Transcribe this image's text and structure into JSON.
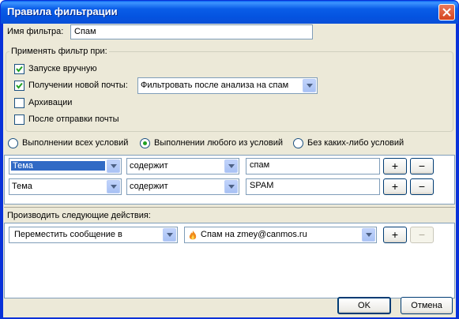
{
  "window": {
    "title": "Правила фильтрации",
    "close_label": "✕"
  },
  "filter_name": {
    "label": "Имя фильтра:",
    "value": "Спам"
  },
  "apply_group": {
    "title": "Применять фильтр при:",
    "options": [
      {
        "label": "Запуске вручную",
        "checked": true
      },
      {
        "label": "Получении новой почты:",
        "checked": true
      },
      {
        "label": "Архивации",
        "checked": false
      },
      {
        "label": "После отправки почты",
        "checked": false
      }
    ],
    "new_mail_mode": "Фильтровать после анализа на спам"
  },
  "match_mode": {
    "options": [
      {
        "label": "Выполнении всех условий",
        "selected": false
      },
      {
        "label": "Выполнении любого из условий",
        "selected": true
      },
      {
        "label": "Без каких-либо условий",
        "selected": false
      }
    ]
  },
  "conditions": [
    {
      "field": "Тема",
      "operator": "содержит",
      "value": "спам",
      "add": "+",
      "remove": "−"
    },
    {
      "field": "Тема",
      "operator": "содержит",
      "value": "SPAM",
      "add": "+",
      "remove": "−"
    }
  ],
  "actions": {
    "title": "Производить следующие действия:",
    "items": [
      {
        "action": "Переместить сообщение в",
        "target": "Спам на zmey@canmos.ru",
        "add": "+",
        "remove": "−"
      }
    ]
  },
  "footer": {
    "ok": "OK",
    "cancel": "Отмена"
  },
  "colors": {
    "titlebar": "#0a5de8",
    "dialog_bg": "#ece9d8",
    "selection": "#316ac5",
    "radio_dot": "#21a121",
    "checkmark": "#21a121"
  }
}
